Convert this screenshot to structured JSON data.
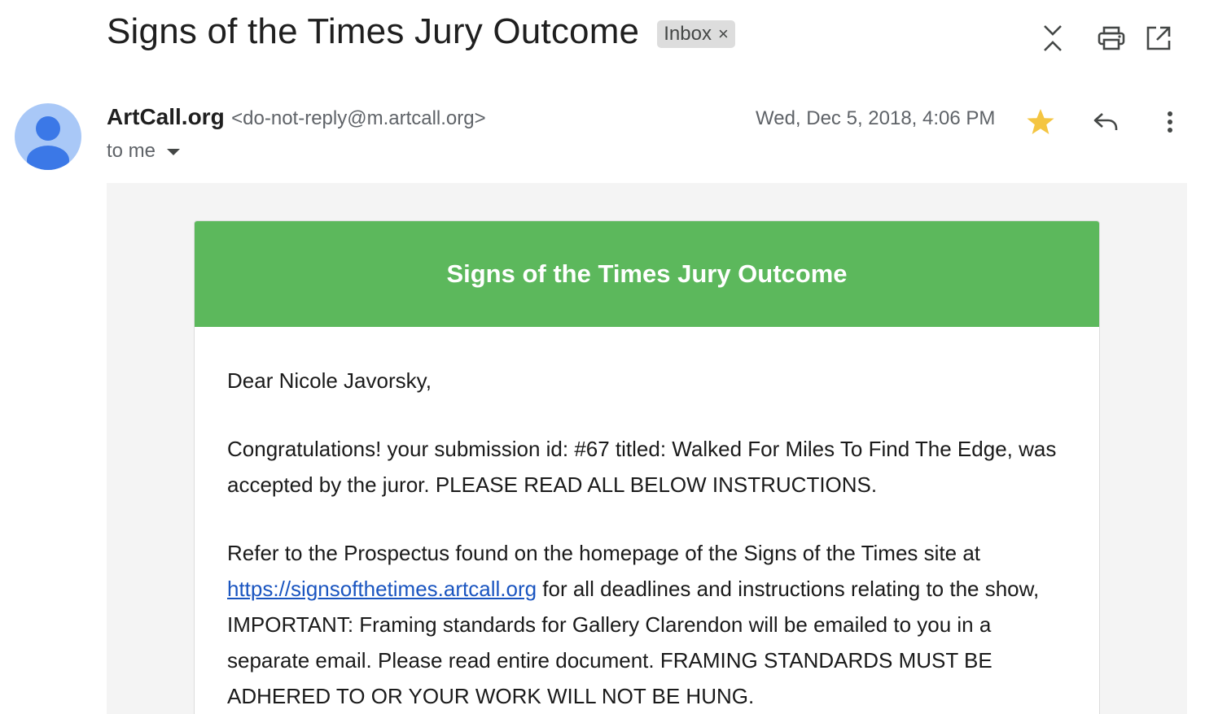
{
  "subject": {
    "title": "Signs of the Times Jury Outcome",
    "label": "Inbox",
    "label_remove": "×"
  },
  "toolbar": {
    "icons": [
      "expand-collapse-icon",
      "print-icon",
      "open-in-new-window-icon"
    ]
  },
  "message": {
    "sender_name": "ArtCall.org",
    "sender_email": "<do-not-reply@m.artcall.org>",
    "to": "to me",
    "date": "Wed, Dec 5, 2018, 4:06 PM",
    "starred": true,
    "star_color": "#f4c542"
  },
  "email": {
    "banner_title": "Signs of the Times Jury Outcome",
    "banner_color": "#5cb85c",
    "greeting": "Dear Nicole Javorsky,",
    "congrats": "Congratulations! your submission id: #67 titled: Walked For Miles To Find The Edge, was accepted by the juror. PLEASE READ ALL BELOW INSTRUCTIONS.",
    "refer_before_link": "Refer to the Prospectus found on the homepage of the Signs of the Times site at ",
    "link_text": "https://signsofthetimes.artcall.org",
    "refer_after_link": " for all deadlines and instructions relating to the show, IMPORTANT: Framing standards for Gallery Clarendon will be emailed to you in a separate email. Please read entire document. FRAMING STANDARDS MUST BE ADHERED TO OR YOUR WORK WILL NOT BE HUNG."
  }
}
